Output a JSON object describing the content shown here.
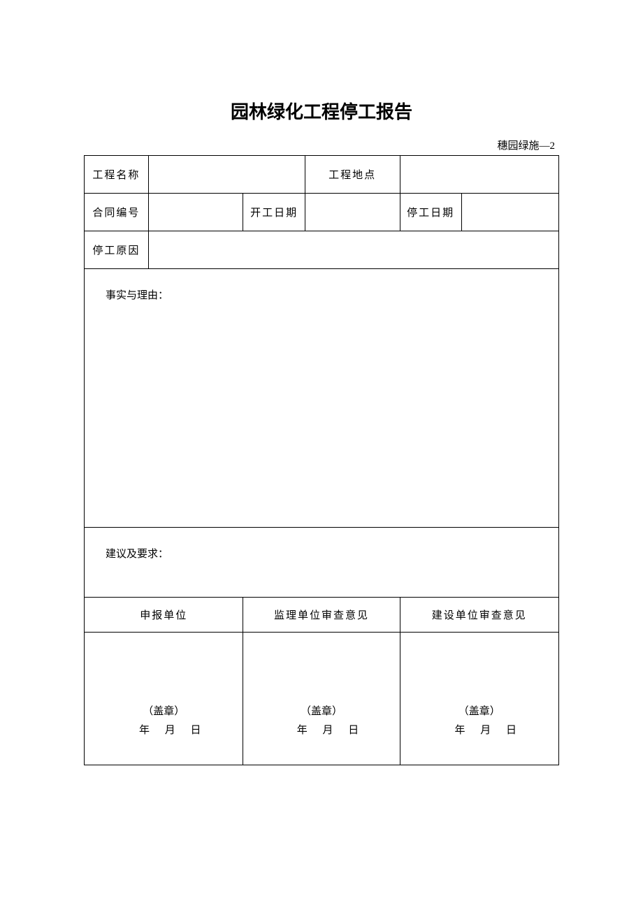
{
  "title": "园林绿化工程停工报告",
  "form_code": "穗园绿施—2",
  "rows": {
    "project_name_label": "工程名称",
    "project_name_value": "",
    "project_location_label": "工程地点",
    "project_location_value": "",
    "contract_no_label": "合同编号",
    "contract_no_value": "",
    "start_date_label": "开工日期",
    "start_date_value": "",
    "stop_date_label": "停工日期",
    "stop_date_value": "",
    "stop_reason_label": "停工原因",
    "stop_reason_value": ""
  },
  "facts_label": "事实与理由：",
  "suggestion_label": "建议及要求：",
  "sig_headers": {
    "applicant": "申报单位",
    "supervisor": "监理单位审查意见",
    "owner": "建设单位审查意见"
  },
  "seal_text": "（盖章）",
  "date_parts": {
    "year": "年",
    "month": "月",
    "day": "日"
  }
}
